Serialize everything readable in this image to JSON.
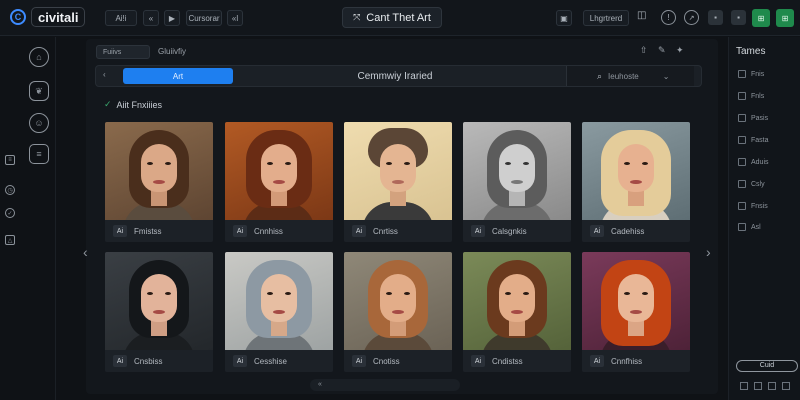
{
  "app": {
    "logo_text": "civitali",
    "logo_mark": "C"
  },
  "topbar": {
    "btn1": "Ai!i",
    "btn2": "«",
    "btn3": "Cursorar",
    "btn4": "«l",
    "title": "Cant Thet Art",
    "right_btn1": "Lhgrtrerd",
    "colors": {
      "green": "#1f8a4c",
      "dark": "#1c2229"
    }
  },
  "toolbar": {
    "pill": "Fuiivs",
    "label": "Gluiivfiy"
  },
  "filter": {
    "active_tab": "Art",
    "center_label": "Cemmwiy Iraried",
    "search_placeholder": "Ieuhoste"
  },
  "section": {
    "title": "Aiit Fnxiiies"
  },
  "cards": [
    {
      "label": "Fmistss",
      "badge": "Ai"
    },
    {
      "label": "Cnnhiss",
      "badge": "Ai"
    },
    {
      "label": "Cnrtiss",
      "badge": "Ai"
    },
    {
      "label": "Calsgnkis",
      "badge": "Ai"
    },
    {
      "label": "Cadehiss",
      "badge": "Ai"
    },
    {
      "label": "Cnsbiss",
      "badge": "Ai"
    },
    {
      "label": "Cesshise",
      "badge": "Ai"
    },
    {
      "label": "Cnotiss",
      "badge": "Ai"
    },
    {
      "label": "Cndistss",
      "badge": "Ai"
    },
    {
      "label": "Cnnfhiss",
      "badge": "Ai"
    }
  ],
  "right_panel": {
    "title": "Tames",
    "items": [
      "Fnis",
      "Fnls",
      "Pasis",
      "Fasta",
      "Aduis",
      "Csly",
      "Fnsis",
      "Asl"
    ],
    "button": "Cuid"
  },
  "pager": {
    "label": "«"
  }
}
